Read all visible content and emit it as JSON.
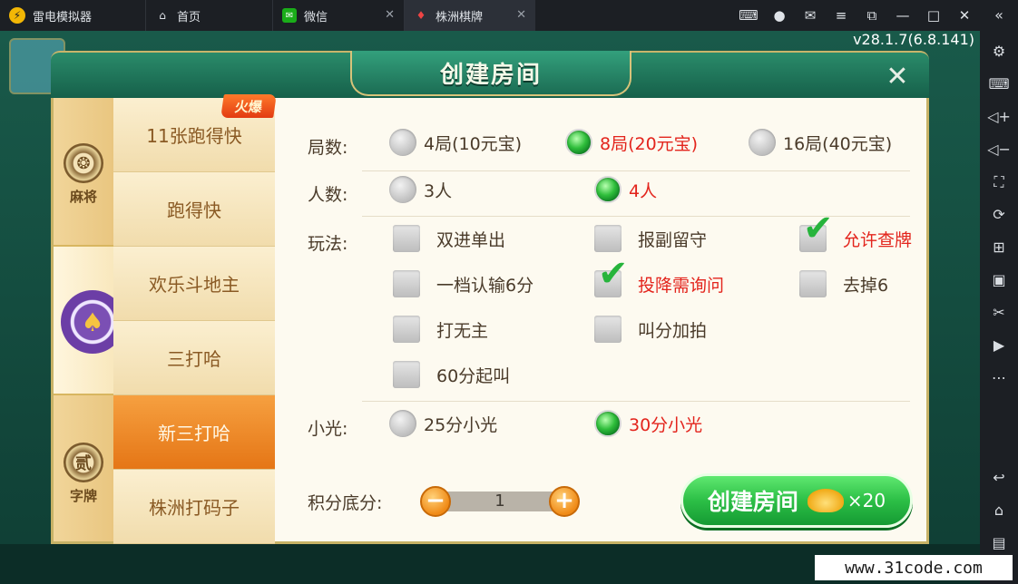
{
  "emulator": {
    "app_name": "雷电模拟器",
    "tabs": [
      {
        "label": "首页"
      },
      {
        "label": "微信"
      },
      {
        "label": "株洲棋牌"
      }
    ],
    "window_controls": [
      "gamepad-icon",
      "user-icon",
      "mail-icon",
      "menu-icon",
      "restore-icon",
      "minimize-icon",
      "maximize-icon",
      "close-icon"
    ],
    "sidebar_icons": [
      "collapse-icon",
      "settings-icon",
      "keyboard-icon",
      "volume-up-icon",
      "volume-down-icon",
      "screenshot-icon",
      "rotate-icon",
      "add-window-icon",
      "apk-icon",
      "scissors-icon",
      "video-icon",
      "more-icon",
      "back-icon",
      "home-icon",
      "recent-icon"
    ]
  },
  "game": {
    "version": "v28.1.7(6.8.141)"
  },
  "dialog": {
    "title": "创建房间",
    "categories": [
      {
        "label": "麻将",
        "icon": "mahjong-icon"
      },
      {
        "label": "",
        "icon": "poker-spade-icon"
      },
      {
        "label": "字牌",
        "icon": "zipai-icon",
        "glyph": "贰"
      }
    ],
    "hot_tag": "火爆",
    "games": [
      {
        "label": "11张跑得快"
      },
      {
        "label": "跑得快"
      },
      {
        "label": "欢乐斗地主"
      },
      {
        "label": "三打哈"
      },
      {
        "label": "新三打哈"
      },
      {
        "label": "株洲打码子"
      }
    ],
    "rows": {
      "rounds": {
        "label": "局数:",
        "options": [
          "4局(10元宝)",
          "8局(20元宝)",
          "16局(40元宝)"
        ],
        "selected": 1
      },
      "players": {
        "label": "人数:",
        "options": [
          "3人",
          "4人"
        ],
        "selected": 1
      },
      "rules": {
        "label": "玩法:",
        "options": [
          {
            "label": "双进单出",
            "checked": false
          },
          {
            "label": "报副留守",
            "checked": false
          },
          {
            "label": "允许查牌",
            "checked": true
          },
          {
            "label": "一档认输6分",
            "checked": false
          },
          {
            "label": "投降需询问",
            "checked": true
          },
          {
            "label": "去掉6",
            "checked": false
          },
          {
            "label": "打无主",
            "checked": false
          },
          {
            "label": "叫分加拍",
            "checked": false
          },
          {
            "label": "60分起叫",
            "checked": false
          }
        ]
      },
      "xiaoguang": {
        "label": "小光:",
        "options": [
          "25分小光",
          "30分小光"
        ],
        "selected": 1
      }
    },
    "score": {
      "label": "积分底分:",
      "value": "1",
      "minus": "−",
      "plus": "+"
    },
    "create_button": {
      "label": "创建房间",
      "cost": "×20"
    }
  },
  "watermark": "www.31code.com",
  "colors": {
    "accent_red": "#e3241c",
    "green": "#2cbf46",
    "panel_bg": "#fdfaf0",
    "tab_bg": "#1c1f24"
  }
}
